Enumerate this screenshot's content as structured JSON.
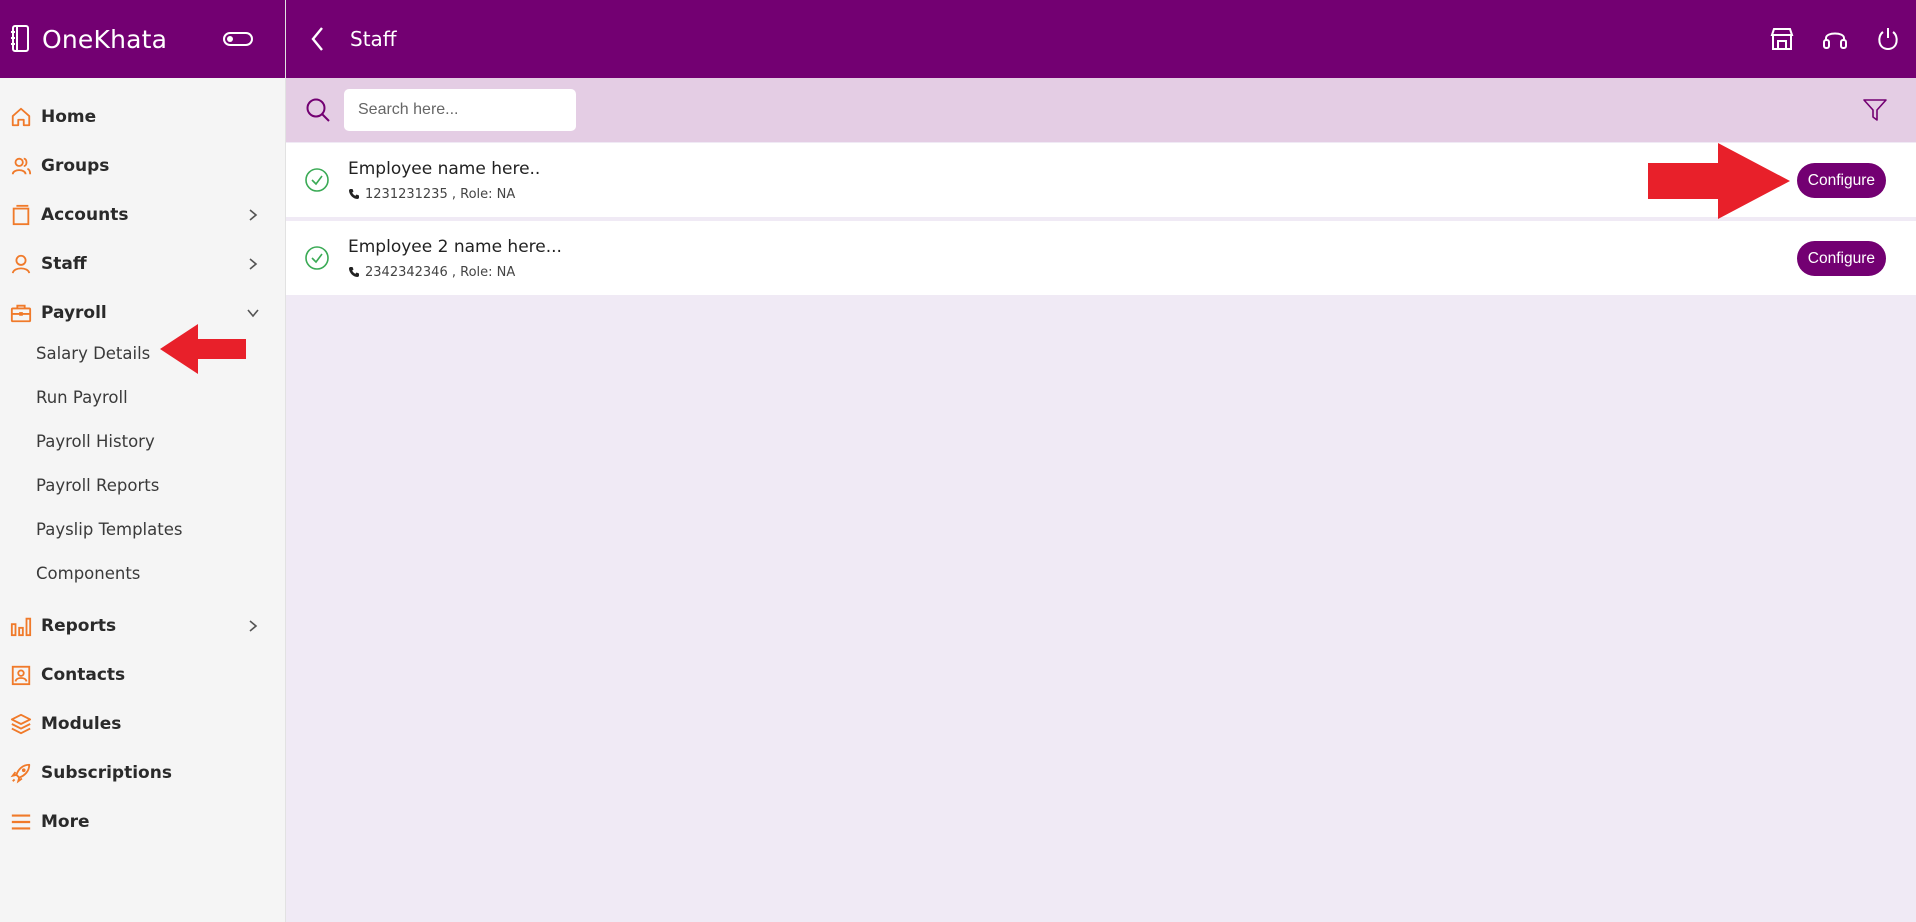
{
  "app": {
    "name": "OneKhata"
  },
  "header": {
    "title": "Staff"
  },
  "sidebar": {
    "items": [
      {
        "label": "Home",
        "icon": "home-icon"
      },
      {
        "label": "Groups",
        "icon": "groups-icon"
      },
      {
        "label": "Accounts",
        "icon": "accounts-icon"
      },
      {
        "label": "Staff",
        "icon": "staff-icon"
      },
      {
        "label": "Payroll",
        "icon": "payroll-icon"
      },
      {
        "label": "Reports",
        "icon": "reports-icon"
      },
      {
        "label": "Contacts",
        "icon": "contacts-icon"
      },
      {
        "label": "Modules",
        "icon": "modules-icon"
      },
      {
        "label": "Subscriptions",
        "icon": "subscriptions-icon"
      },
      {
        "label": "More",
        "icon": "menu-icon"
      }
    ],
    "payroll_sub": [
      "Salary Details",
      "Run Payroll",
      "Payroll History",
      "Payroll Reports",
      "Payslip Templates",
      "Components"
    ]
  },
  "search": {
    "placeholder": "Search here..."
  },
  "employees": [
    {
      "name": "Employee name here..",
      "phone": "1231231235",
      "role_text": ", Role: NA",
      "action": "Configure"
    },
    {
      "name": "Employee 2 name here...",
      "phone": "2342342346",
      "role_text": ", Role: NA",
      "action": "Configure"
    }
  ],
  "colors": {
    "brand": "#730072",
    "accent_icon": "#f07a2a",
    "arrow": "#e8202a",
    "success": "#3aaa55"
  }
}
